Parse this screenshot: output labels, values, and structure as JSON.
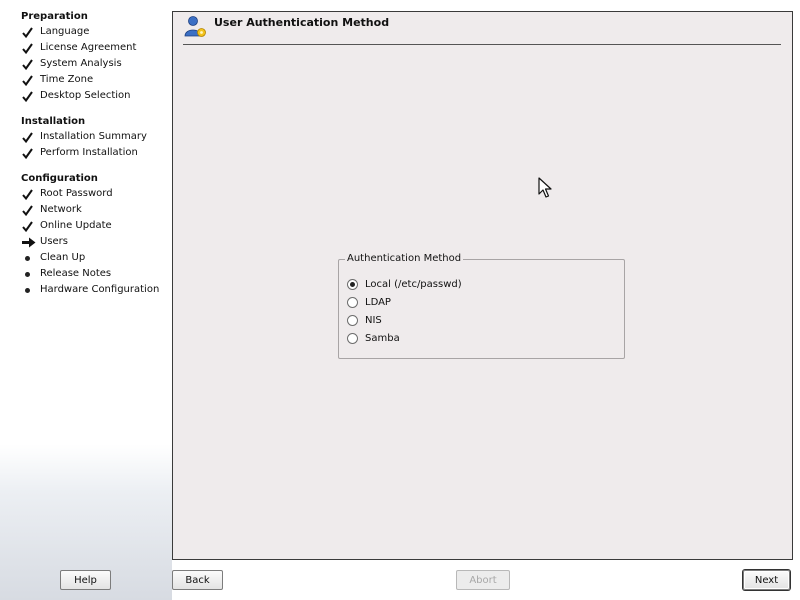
{
  "sidebar": {
    "sections": [
      {
        "title": "Preparation",
        "steps": [
          {
            "label": "Language",
            "status": "done"
          },
          {
            "label": "License Agreement",
            "status": "done"
          },
          {
            "label": "System Analysis",
            "status": "done"
          },
          {
            "label": "Time Zone",
            "status": "done"
          },
          {
            "label": "Desktop Selection",
            "status": "done"
          }
        ]
      },
      {
        "title": "Installation",
        "steps": [
          {
            "label": "Installation Summary",
            "status": "done"
          },
          {
            "label": "Perform Installation",
            "status": "done"
          }
        ]
      },
      {
        "title": "Configuration",
        "steps": [
          {
            "label": "Root Password",
            "status": "done"
          },
          {
            "label": "Network",
            "status": "done"
          },
          {
            "label": "Online Update",
            "status": "done"
          },
          {
            "label": "Users",
            "status": "current"
          },
          {
            "label": "Clean Up",
            "status": "pending"
          },
          {
            "label": "Release Notes",
            "status": "pending"
          },
          {
            "label": "Hardware Configuration",
            "status": "pending"
          }
        ]
      }
    ]
  },
  "panel": {
    "title": "User Authentication Method",
    "icon": "user-icon"
  },
  "auth": {
    "legend": "Authentication Method",
    "options": [
      {
        "label": "Local (/etc/passwd)",
        "checked": true
      },
      {
        "label": "LDAP",
        "checked": false
      },
      {
        "label": "NIS",
        "checked": false
      },
      {
        "label": "Samba",
        "checked": false
      }
    ]
  },
  "buttons": {
    "help": "Help",
    "back": "Back",
    "abort": "Abort",
    "next": "Next"
  },
  "colors": {
    "panel_bg": "#efebec",
    "check_mark": "#111111",
    "icon_blue": "#3b6fc4"
  }
}
